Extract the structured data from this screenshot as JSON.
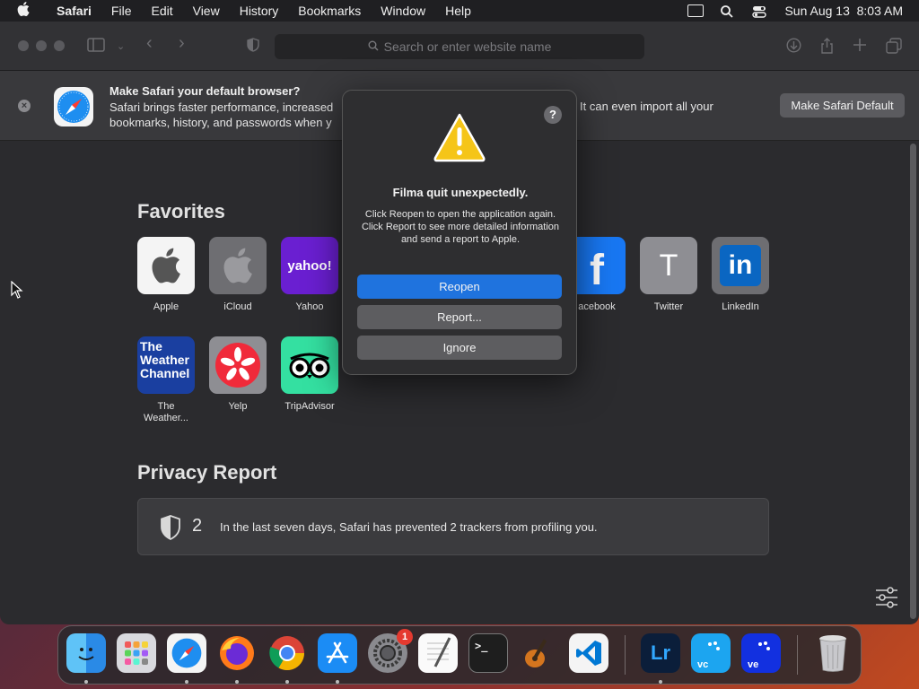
{
  "menubar": {
    "app_name": "Safari",
    "items": [
      "File",
      "Edit",
      "View",
      "History",
      "Bookmarks",
      "Window",
      "Help"
    ],
    "datetime": "Sun Aug 13  8:03 AM"
  },
  "toolbar": {
    "address_placeholder": "Search or enter website name"
  },
  "banner": {
    "title": "Make Safari your default browser?",
    "description_line1": "Safari brings faster performance, increased",
    "description_line2": "bookmarks, history, and passwords when y",
    "description_right": "It can even import all your",
    "button_label": "Make Safari Default"
  },
  "favorites": {
    "title": "Favorites",
    "items": [
      {
        "label": "Apple",
        "icon": "apple-logo-icon"
      },
      {
        "label": "iCloud",
        "icon": "icloud-logo-icon"
      },
      {
        "label": "Yahoo",
        "icon": "yahoo-logo-icon",
        "tile_text": "yahoo!"
      },
      {
        "label": "Facebook",
        "display_label": "acebook",
        "icon": "facebook-logo-icon"
      },
      {
        "label": "Twitter",
        "icon": "letter-t-icon",
        "tile_text": "T"
      },
      {
        "label": "LinkedIn",
        "icon": "linkedin-logo-icon",
        "tile_text": "in"
      },
      {
        "label": "The Weather...",
        "label_line1": "The",
        "label_line2": "Weather...",
        "icon": "weather-channel-logo-icon",
        "tile_text": [
          "The",
          "Weather",
          "Channel"
        ]
      },
      {
        "label": "Yelp",
        "icon": "yelp-logo-icon"
      },
      {
        "label": "TripAdvisor",
        "icon": "tripadvisor-logo-icon"
      }
    ]
  },
  "privacy": {
    "title": "Privacy Report",
    "count": "2",
    "text": "In the last seven days, Safari has prevented 2 trackers from profiling you."
  },
  "dialog": {
    "title": "Filma quit unexpectedly.",
    "message": "Click Reopen to open the application again. Click Report to see more detailed information and send a report to Apple.",
    "help_label": "?",
    "buttons": {
      "reopen": "Reopen",
      "report": "Report...",
      "ignore": "Ignore"
    }
  },
  "dock": {
    "apps": [
      "Finder",
      "Launchpad",
      "Safari",
      "Firefox",
      "Chrome",
      "App Store",
      "System Settings",
      "TextEdit",
      "Terminal",
      "GarageBand",
      "Visual Studio Code",
      "Lightroom",
      "VC App",
      "VC App 2",
      "Trash"
    ],
    "settings_badge": "1",
    "lightroom_text": "Lr",
    "vc_text": "vc",
    "ve_text": "ve"
  },
  "colors": {
    "accent": "#1f73de",
    "badge": "#e5392f",
    "warning": "#f5c518"
  }
}
